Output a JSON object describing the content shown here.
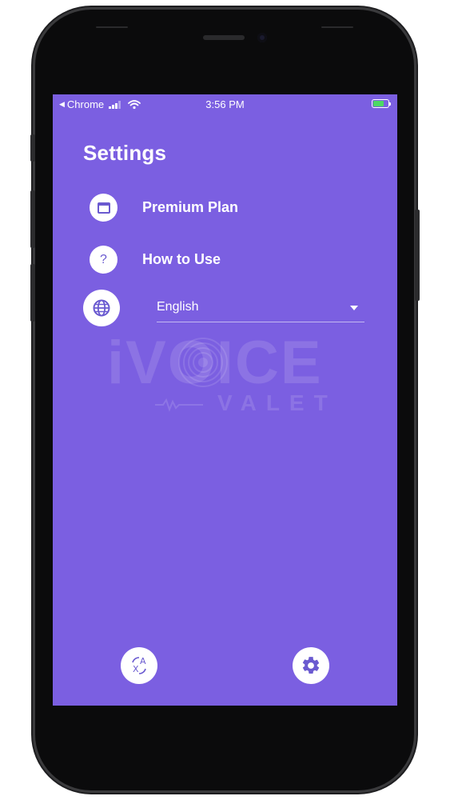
{
  "status_bar": {
    "back_app": "Chrome",
    "time": "3:56 PM"
  },
  "settings": {
    "title": "Settings",
    "items": [
      {
        "label": "Premium Plan",
        "icon": "window-icon"
      },
      {
        "label": "How to Use",
        "icon": "question-icon",
        "glyph": "?"
      }
    ],
    "language": {
      "icon": "globe-icon",
      "selected": "English"
    }
  },
  "watermark": {
    "main": "iVOICE",
    "sub": "VALET"
  },
  "bottom_nav": [
    {
      "name": "translate",
      "icon": "translate-icon"
    },
    {
      "name": "settings",
      "icon": "gear-icon"
    }
  ],
  "colors": {
    "background": "#7b5fe1",
    "icon_bg": "#ffffff",
    "accent": "#6a5ad0"
  }
}
